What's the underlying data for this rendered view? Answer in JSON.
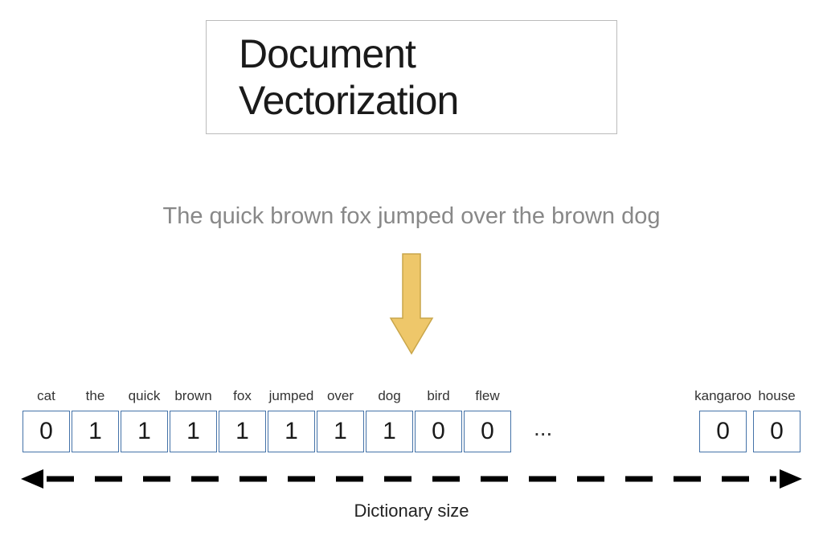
{
  "title": "Document Vectorization",
  "sentence": "The quick brown fox jumped over the brown dog",
  "vector": {
    "left": [
      {
        "label": "cat",
        "value": "0"
      },
      {
        "label": "the",
        "value": "1"
      },
      {
        "label": "quick",
        "value": "1"
      },
      {
        "label": "brown",
        "value": "1"
      },
      {
        "label": "fox",
        "value": "1"
      },
      {
        "label": "jumped",
        "value": "1"
      },
      {
        "label": "over",
        "value": "1"
      },
      {
        "label": "dog",
        "value": "1"
      },
      {
        "label": "bird",
        "value": "0"
      },
      {
        "label": "flew",
        "value": "0"
      }
    ],
    "ellipsis": "...",
    "right": [
      {
        "label": "kangaroo",
        "value": "0"
      },
      {
        "label": "house",
        "value": "0"
      }
    ]
  },
  "dict_label": "Dictionary size",
  "colors": {
    "arrow_fill": "#eec76a",
    "arrow_stroke": "#c9a64a",
    "box_border": "#4472a8"
  }
}
